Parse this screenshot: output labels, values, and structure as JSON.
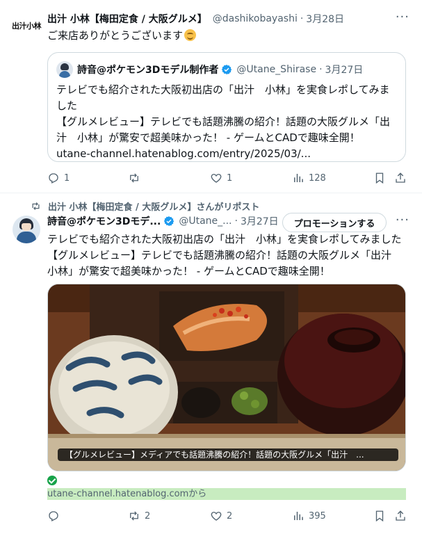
{
  "post1": {
    "avatar_text": "出汁小林",
    "author_name": "出汁 小林【梅田定食 / 大阪グルメ】",
    "handle": "@dashikobayashi",
    "separator": "·",
    "date": "3月28日",
    "more": "···",
    "text": "ご来店ありがとうございます",
    "emoji": "smiling-face-emoji",
    "quote": {
      "author_name": "詩音@ポケモン3Dモデル制作者",
      "handle": "@Utane_Shirase",
      "separator": "·",
      "date": "3月27日",
      "line1": "テレビでも紹介された大阪初出店の「出汁　小林」を実食レポしてみま",
      "line2": "した",
      "line3": "【グルメレビュー】テレビでも話題沸騰の紹介！話題の大阪グルメ「出",
      "line4": "汁　小林」が驚安で超美味かった！ - ゲームとCADで趣味全開！",
      "line5": "utane-channel.hatenablog.com/entry/2025/03/..."
    },
    "actions": {
      "replies": "1",
      "reposts": "",
      "likes": "1",
      "views": "128"
    }
  },
  "post2": {
    "repost_label": "出汁 小林【梅田定食 / 大阪グルメ】さんがリポスト",
    "author_name": "詩音@ポケモン3Dモデ...",
    "handle": "@Utane_...",
    "separator": "·",
    "date": "3月27日",
    "promote_label": "プロモーションする",
    "more": "···",
    "line1": "テレビでも紹介された大阪初出店の「出汁　小林」を実食レポしてみました",
    "line2": "【グルメレビュー】テレビでも話題沸騰の紹介！話題の大阪グルメ「出汁",
    "line3": "小林」が驚安で超美味かった！ - ゲームとCADで趣味全開！",
    "media_caption": "【グルメレビュー】メディアでも話題沸騰の紹介！話題の大阪グルメ「出汁　...",
    "source_link": "utane-channel.hatenablog.comから",
    "actions": {
      "replies": "",
      "reposts": "2",
      "likes": "2",
      "views": "395"
    }
  },
  "colors": {
    "text": "#0f1419",
    "muted": "#536471",
    "verified": "#1d9bf0",
    "border": "#cfd9de",
    "link_highlight": "#c8ecc0"
  }
}
